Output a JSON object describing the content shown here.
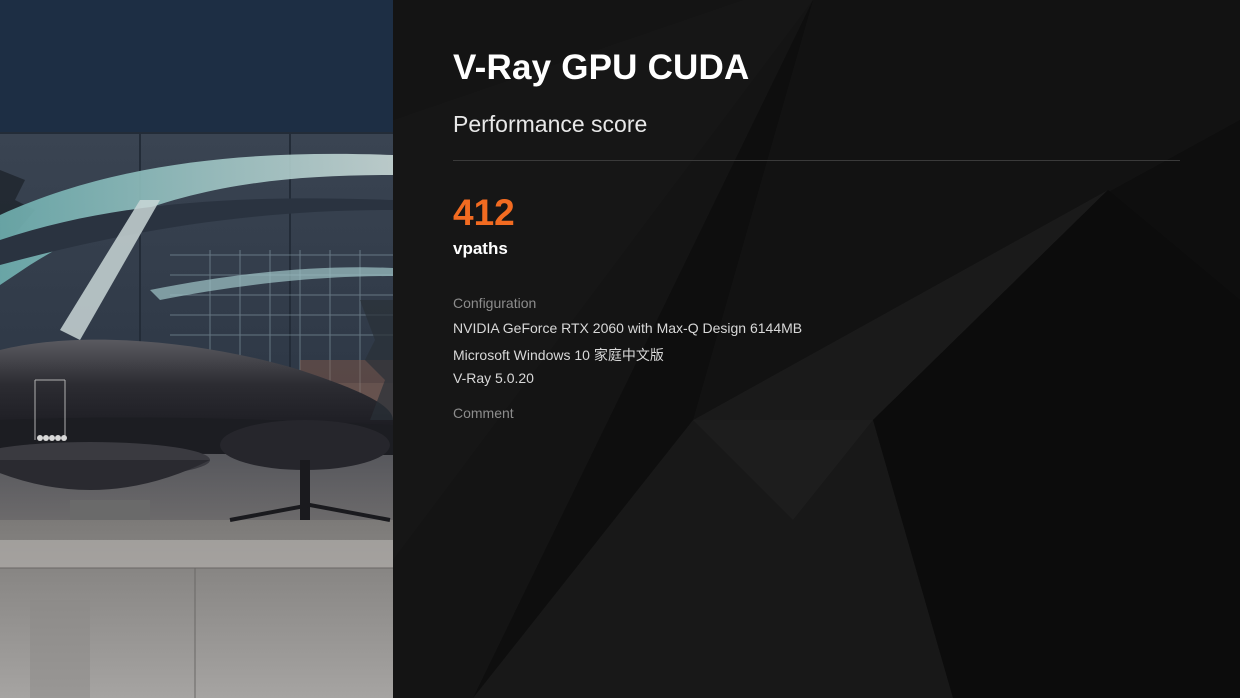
{
  "benchmark": {
    "title": "V-Ray GPU CUDA",
    "subtitle": "Performance score"
  },
  "score": {
    "value": "412",
    "unit": "vpaths"
  },
  "configuration": {
    "label": "Configuration",
    "lines": [
      "NVIDIA GeForce RTX 2060 with Max-Q Design 6144MB",
      "Microsoft Windows 10 家庭中文版",
      "V-Ray 5.0.20"
    ]
  },
  "comment": {
    "label": "Comment"
  },
  "colors": {
    "accent": "#f26b21",
    "background": "#0e0e0e",
    "title": "#ffffff",
    "muted": "#8c8c8c"
  }
}
